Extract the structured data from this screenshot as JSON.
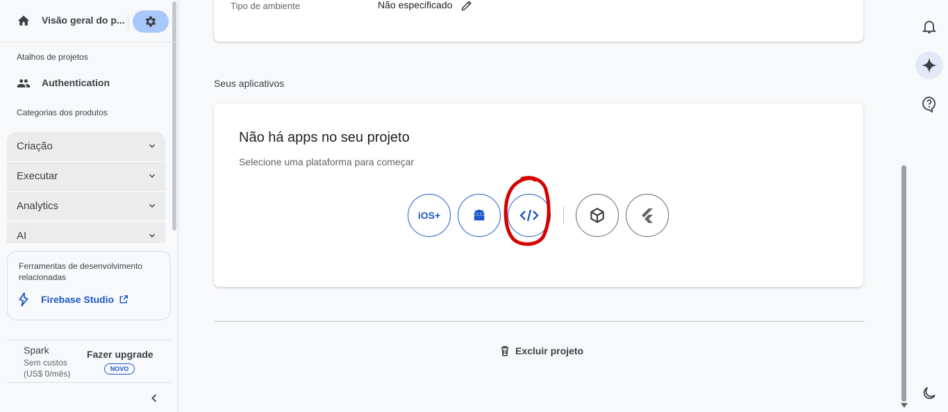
{
  "sidebar": {
    "overview_title": "Visão geral do p...",
    "shortcuts_label": "Atalhos de projetos",
    "auth_label": "Authentication",
    "categories_label": "Categorias dos produtos",
    "categories": [
      {
        "label": "Criação"
      },
      {
        "label": "Executar"
      },
      {
        "label": "Analytics"
      },
      {
        "label": "AI"
      }
    ],
    "tools_text": "Ferramentas de desenvolvimento relacionadas",
    "studio_label": "Firebase Studio",
    "plan_name": "Spark",
    "plan_sub": "Sem custos (US$ 0/mês)",
    "upgrade_label": "Fazer upgrade",
    "badge": "NOVO"
  },
  "main": {
    "env_label": "Tipo de ambiente",
    "env_value": "Não especificado",
    "apps_title": "Seus aplicativos",
    "empty_title": "Não há apps no seu projeto",
    "empty_sub": "Selecione uma plataforma para começar",
    "platforms": {
      "ios": "iOS+"
    },
    "delete_label": "Excluir projeto"
  },
  "colors": {
    "accent": "#1a57c8",
    "settings_bg": "#a8c7fa",
    "annotation": "#d50000"
  }
}
